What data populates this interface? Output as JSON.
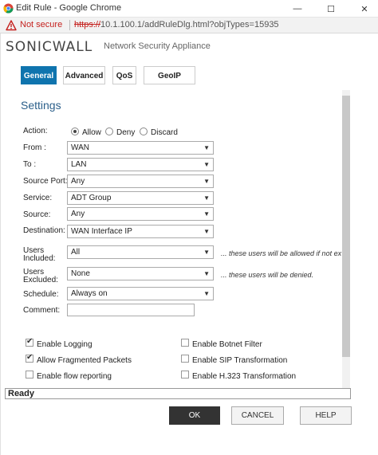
{
  "window": {
    "title": "Edit Rule - Google Chrome",
    "min_glyph": "—",
    "max_glyph": "☐",
    "close_glyph": "✕"
  },
  "addressbar": {
    "security": "Not secure",
    "scheme": "https://",
    "url_rest": "10.1.100.1/addRuleDlg.html?objTypes=15935"
  },
  "header": {
    "logo_part1": "SONIC",
    "logo_part2": "WALL",
    "app_name": "Network Security Appliance"
  },
  "tabs": [
    {
      "label": "General",
      "active": true
    },
    {
      "label": "Advanced",
      "active": false
    },
    {
      "label": "QoS",
      "active": false
    },
    {
      "label": "GeoIP",
      "active": false
    }
  ],
  "settings": {
    "title": "Settings",
    "action": {
      "label": "Action:",
      "options": [
        {
          "label": "Allow",
          "selected": true
        },
        {
          "label": "Deny",
          "selected": false
        },
        {
          "label": "Discard",
          "selected": false
        }
      ]
    },
    "from": {
      "label": "From :",
      "value": "WAN"
    },
    "to": {
      "label": "To :",
      "value": "LAN"
    },
    "source_port": {
      "label": "Source Port:",
      "value": "Any"
    },
    "service": {
      "label": "Service:",
      "value": "ADT Group"
    },
    "source": {
      "label": "Source:",
      "value": "Any"
    },
    "destination": {
      "label": "Destination:",
      "value": "WAN Interface IP"
    },
    "users_included": {
      "label_line1": "Users",
      "label_line2": "Included:",
      "value": "All",
      "hint": "... these users will be allowed if not ex"
    },
    "users_excluded": {
      "label_line1": "Users",
      "label_line2": "Excluded:",
      "value": "None",
      "hint": "... these users will be denied."
    },
    "schedule": {
      "label": "Schedule:",
      "value": "Always on"
    },
    "comment": {
      "label": "Comment:",
      "value": ""
    },
    "checkboxes_left": [
      {
        "label": "Enable Logging",
        "checked": true
      },
      {
        "label": "Allow Fragmented Packets",
        "checked": true
      },
      {
        "label": "Enable flow reporting",
        "checked": false
      }
    ],
    "checkboxes_right": [
      {
        "label": "Enable Botnet Filter",
        "checked": false
      },
      {
        "label": "Enable SIP Transformation",
        "checked": false
      },
      {
        "label": "Enable H.323 Transformation",
        "checked": false
      }
    ]
  },
  "status": {
    "text": "Ready"
  },
  "buttons": {
    "ok": "OK",
    "cancel": "CANCEL",
    "help": "HELP"
  },
  "colors": {
    "accent": "#0f74ae",
    "warning": "#c5221f"
  }
}
